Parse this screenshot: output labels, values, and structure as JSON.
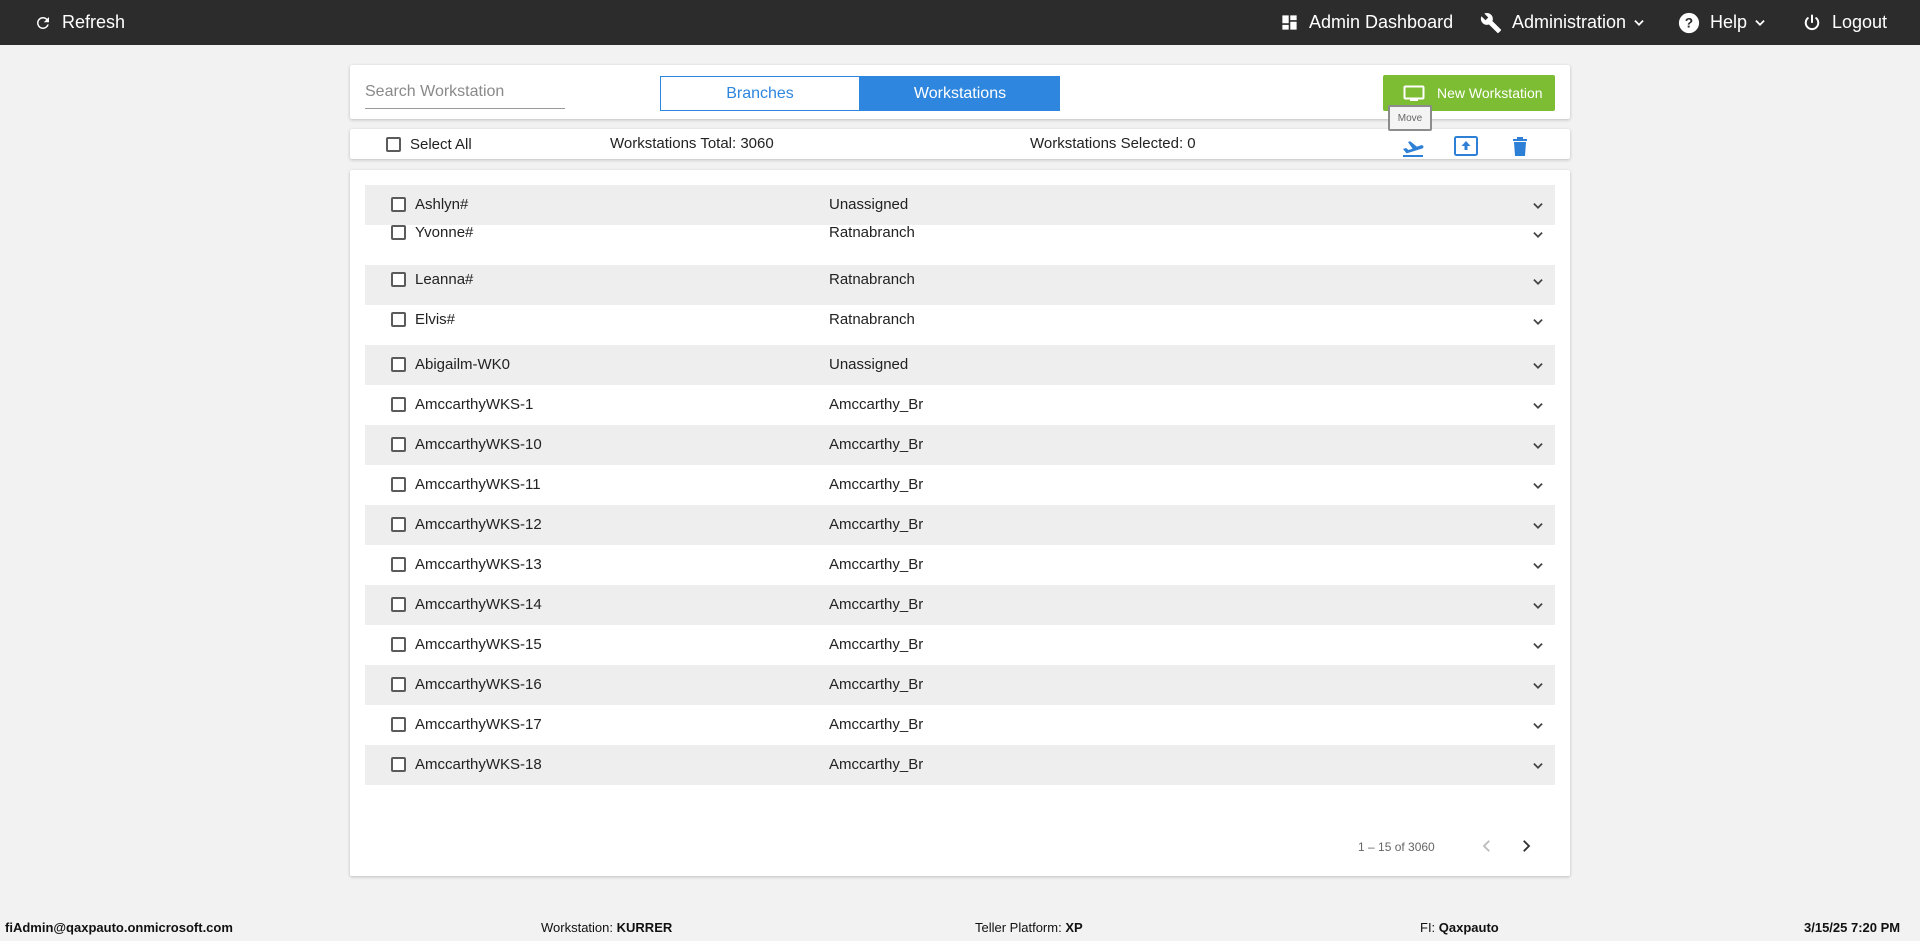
{
  "topbar": {
    "refresh_label": "Refresh",
    "admin_dashboard_label": "Admin Dashboard",
    "administration_label": "Administration",
    "help_label": "Help",
    "logout_label": "Logout"
  },
  "header": {
    "search_placeholder": "Search Workstation",
    "tab_branches": "Branches",
    "tab_workstations": "Workstations",
    "new_workstation_label": "New Workstation",
    "tooltip_move": "Move"
  },
  "toolbar": {
    "select_all_label": "Select All",
    "total_text": "Workstations Total: 3060",
    "selected_text": "Workstations Selected: 0"
  },
  "rows": [
    {
      "name": "Ashlyn#",
      "branch": "Unassigned"
    },
    {
      "name": "Yvonne#",
      "branch": "Ratnabranch"
    },
    {
      "name": "Leanna#",
      "branch": "Ratnabranch"
    },
    {
      "name": "Elvis#",
      "branch": "Ratnabranch"
    },
    {
      "name": "Abigailm-WK0",
      "branch": "Unassigned"
    },
    {
      "name": "AmccarthyWKS-1",
      "branch": "Amccarthy_Br"
    },
    {
      "name": "AmccarthyWKS-10",
      "branch": "Amccarthy_Br"
    },
    {
      "name": "AmccarthyWKS-11",
      "branch": "Amccarthy_Br"
    },
    {
      "name": "AmccarthyWKS-12",
      "branch": "Amccarthy_Br"
    },
    {
      "name": "AmccarthyWKS-13",
      "branch": "Amccarthy_Br"
    },
    {
      "name": "AmccarthyWKS-14",
      "branch": "Amccarthy_Br"
    },
    {
      "name": "AmccarthyWKS-15",
      "branch": "Amccarthy_Br"
    },
    {
      "name": "AmccarthyWKS-16",
      "branch": "Amccarthy_Br"
    },
    {
      "name": "AmccarthyWKS-17",
      "branch": "Amccarthy_Br"
    },
    {
      "name": "AmccarthyWKS-18",
      "branch": "Amccarthy_Br"
    }
  ],
  "pagination": {
    "range_text": "1 – 15 of 3060"
  },
  "footer": {
    "user": "fiAdmin@qaxpauto.onmicrosoft.com",
    "workstation_label": "Workstation:",
    "workstation_value": "KURRER",
    "platform_label": "Teller Platform:",
    "platform_value": "XP",
    "fi_label": "FI:",
    "fi_value": "Qaxpauto",
    "datetime": "3/15/25 7:20 PM"
  },
  "colors": {
    "topbar_bg": "#2c2c2c",
    "accent_blue": "#2e86de",
    "new_button_green": "#7cbd33",
    "row_shade": "#eeeeee",
    "icon_blue": "#2e7fd6"
  }
}
